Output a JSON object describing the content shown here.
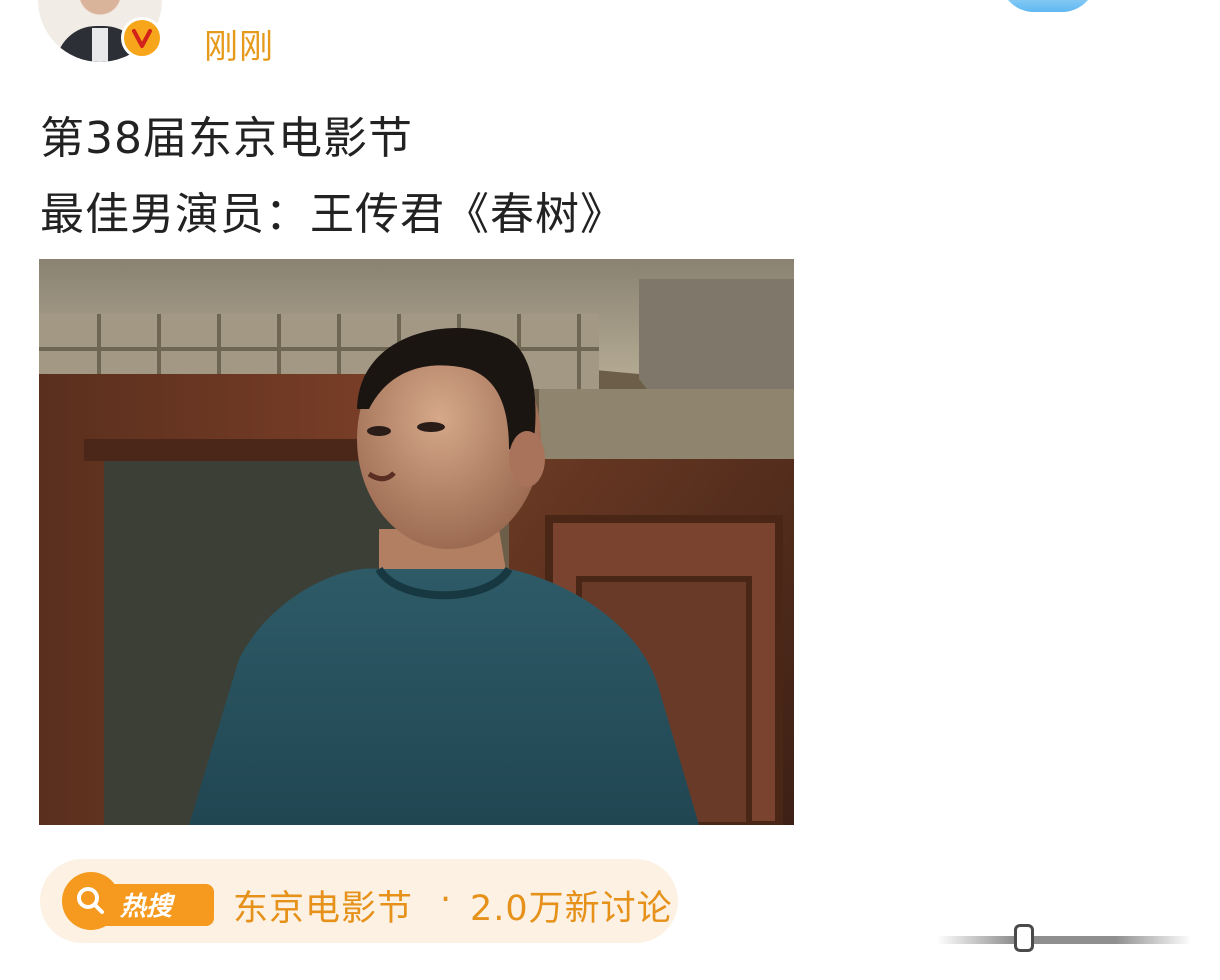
{
  "post": {
    "time": "刚刚",
    "verified_badge": "V",
    "text_lines": [
      "第38届东京电影节",
      "最佳男演员：王传君《春树》"
    ]
  },
  "hot_search": {
    "badge_label": "热搜",
    "topic": "东京电影节",
    "separator": "·",
    "count": "2.0万新讨论"
  },
  "icons": {
    "verified": "verified-v-icon",
    "search": "magnifier-icon",
    "handle": "drag-handle-icon"
  },
  "colors": {
    "accent_orange": "#f59a1e",
    "time_text": "#e69a1c",
    "hot_text": "#e5911a",
    "pill_bg": "#fdf1e4"
  }
}
